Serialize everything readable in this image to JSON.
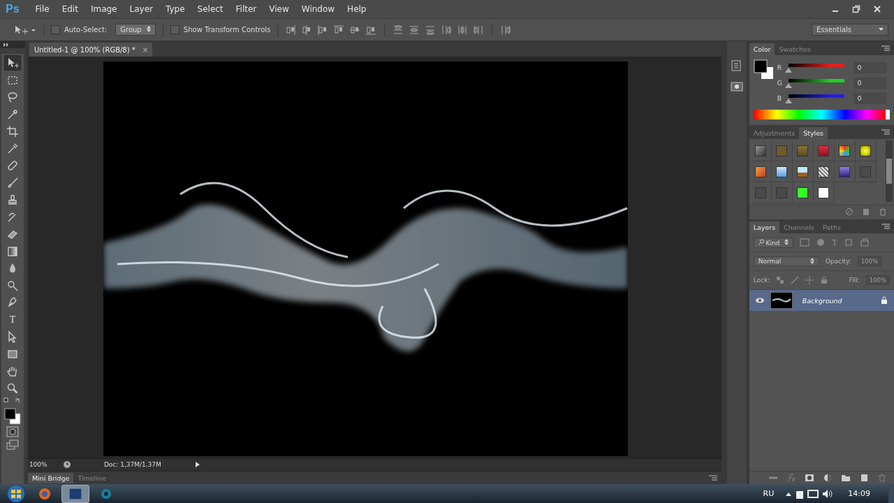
{
  "app_logo": "Ps",
  "menu": [
    "File",
    "Edit",
    "Image",
    "Layer",
    "Type",
    "Select",
    "Filter",
    "View",
    "Window",
    "Help"
  ],
  "options_bar": {
    "auto_select": {
      "label": "Auto-Select:",
      "checked": false
    },
    "target": "Group",
    "show_transform": {
      "label": "Show Transform Controls",
      "checked": false
    }
  },
  "workspace": "Essentials",
  "document_tab": {
    "title": "Untitled-1 @ 100% (RGB/8) *",
    "close": "×"
  },
  "tools": [
    {
      "kind": "move",
      "selected": true
    },
    {
      "kind": "marquee",
      "selected": false
    },
    {
      "kind": "lasso",
      "selected": false
    },
    {
      "kind": "quick-select",
      "selected": false
    },
    {
      "kind": "crop",
      "selected": false
    },
    {
      "kind": "eyedropper",
      "selected": false
    },
    {
      "kind": "healing",
      "selected": false
    },
    {
      "kind": "brush",
      "selected": false
    },
    {
      "kind": "stamp",
      "selected": false
    },
    {
      "kind": "history-brush",
      "selected": false
    },
    {
      "kind": "eraser",
      "selected": false
    },
    {
      "kind": "gradient",
      "selected": false
    },
    {
      "kind": "blur",
      "selected": false
    },
    {
      "kind": "dodge",
      "selected": false
    },
    {
      "kind": "pen",
      "selected": false
    },
    {
      "kind": "type",
      "selected": false,
      "glyph": "T"
    },
    {
      "kind": "path-select",
      "selected": false
    },
    {
      "kind": "shape",
      "selected": false
    },
    {
      "kind": "hand",
      "selected": false
    },
    {
      "kind": "zoom",
      "selected": false
    }
  ],
  "status_bar": {
    "zoom": "100%",
    "doc_info": "Doc: 1,37M/1,37M"
  },
  "bottom_tabs": [
    {
      "label": "Mini Bridge",
      "selected": true
    },
    {
      "label": "Timeline",
      "selected": false
    }
  ],
  "color_panel": {
    "tabs": [
      {
        "label": "Color",
        "selected": true
      },
      {
        "label": "Swatches",
        "selected": false
      }
    ],
    "channels": [
      {
        "name": "R",
        "level": 0,
        "value": "0",
        "color": "#e02020"
      },
      {
        "name": "G",
        "level": 0,
        "value": "0",
        "color": "#20d020"
      },
      {
        "name": "B",
        "level": 0,
        "value": "0",
        "color": "#2020e0"
      }
    ]
  },
  "styles_panel": {
    "tabs": [
      {
        "label": "Adjustments",
        "selected": false
      },
      {
        "label": "Styles",
        "selected": true
      }
    ]
  },
  "layers_panel": {
    "tabs": [
      {
        "label": "Layers",
        "selected": true
      },
      {
        "label": "Channels",
        "selected": false
      },
      {
        "label": "Paths",
        "selected": false
      }
    ],
    "filter": "Kind",
    "filter_type_glyph": "T",
    "blend_mode": "Normal",
    "opacity_label": "Opacity:",
    "opacity": "100%",
    "lock_label": "Lock:",
    "fill_label": "Fill:",
    "fill": "100%",
    "layers": [
      {
        "name": "Background",
        "visible": true,
        "locked": true,
        "selected": true
      }
    ]
  },
  "taskbar": {
    "language": "RU",
    "time": "14:09"
  }
}
